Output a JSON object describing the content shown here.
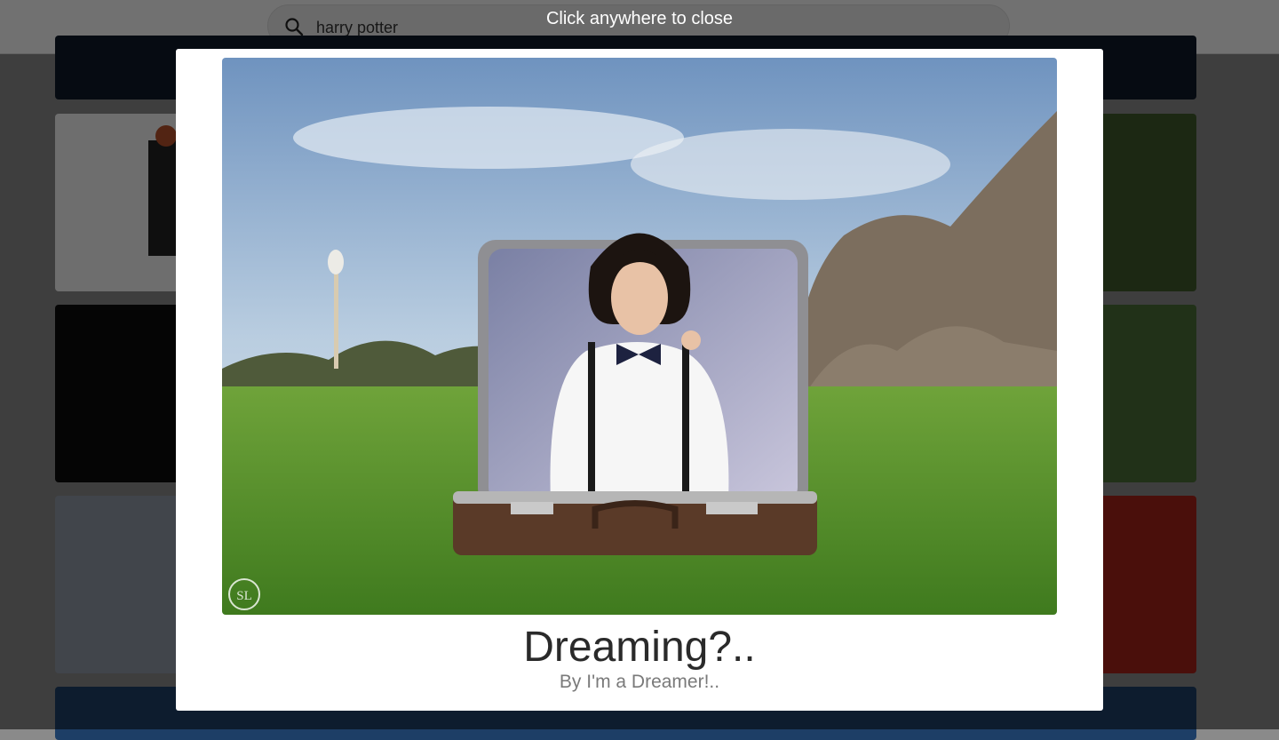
{
  "search": {
    "value": "harry potter",
    "icon": "search-icon"
  },
  "lightbox": {
    "close_hint": "Click anywhere to close",
    "title": "Dreaming?..",
    "author": "By I'm a Dreamer!..",
    "watermark": "SL"
  }
}
